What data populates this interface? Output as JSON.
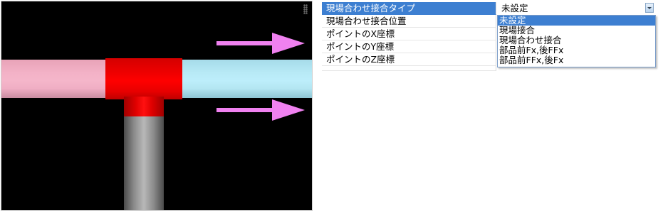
{
  "properties": {
    "rows": [
      {
        "label": "現場合わせ接合タイプ"
      },
      {
        "label": "現場合わせ接合位置"
      },
      {
        "label": "ポイントのX座標"
      },
      {
        "label": "ポイントのY座標"
      },
      {
        "label": "ポイントのZ座標"
      }
    ],
    "combo": {
      "value": "未設定",
      "options": [
        "未設定",
        "現場接合",
        "現場合わせ接合",
        "部品前Fx,後FFx",
        "部品前FFx,後Fx"
      ]
    }
  },
  "viewport": {
    "colors": {
      "background": "#000000",
      "pipe_left": "#f4b4c8",
      "pipe_right": "#bcecfa",
      "joint": "#ff0000",
      "pipe_vertical": "#a8a8a8",
      "arrow": "#f081f0"
    }
  }
}
